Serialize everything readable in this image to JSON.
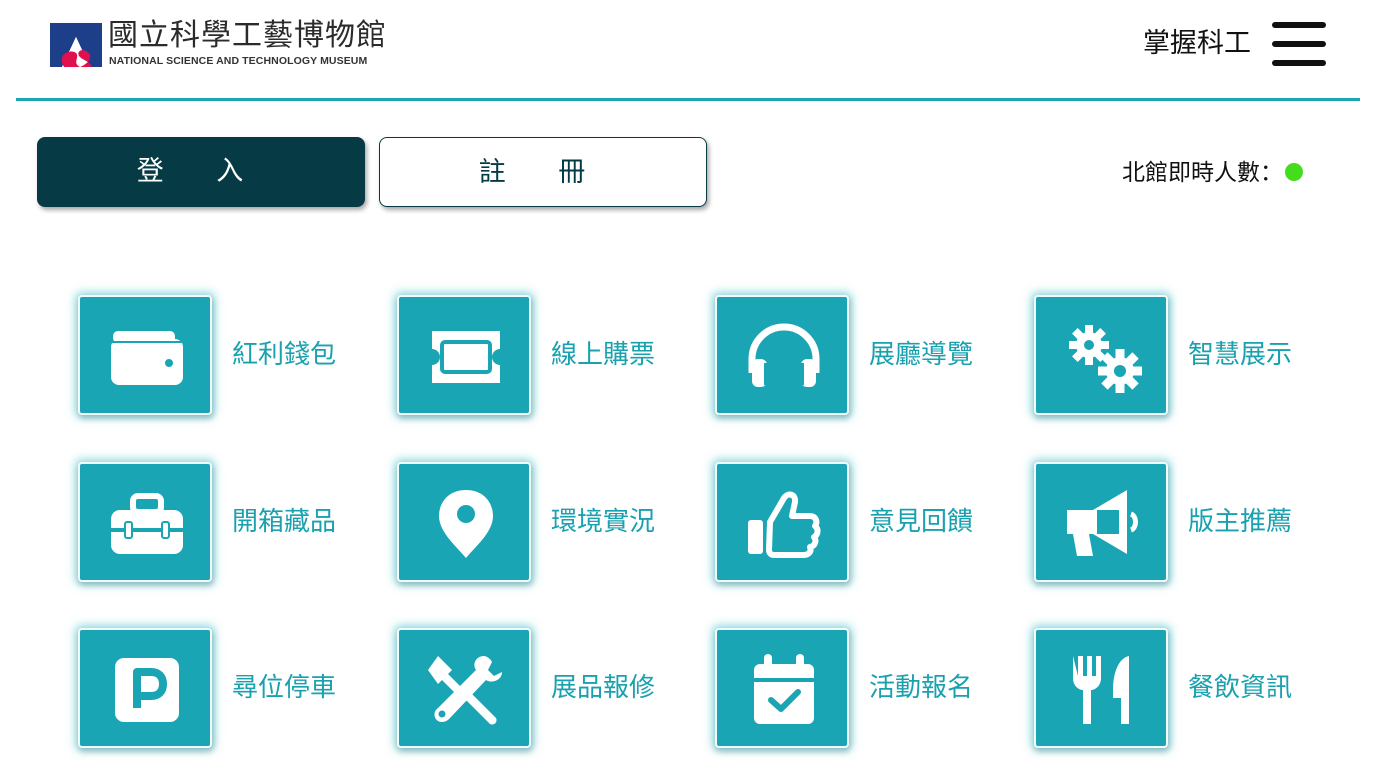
{
  "header": {
    "logo_zh": "國立科學工藝博物館",
    "logo_en": "NATIONAL SCIENCE AND TECHNOLOGY MUSEUM",
    "brand_link": "掌握科工",
    "menu_icon": "hamburger-menu-icon"
  },
  "auth": {
    "login_label": "登 入",
    "register_label": "註 冊"
  },
  "visitors": {
    "label": "北館即時人數：",
    "status_color": "#44dd1e"
  },
  "colors": {
    "accent": "#1aa5b5",
    "dark": "#063a45"
  },
  "grid": [
    {
      "label": "紅利錢包",
      "icon": "wallet-icon"
    },
    {
      "label": "線上購票",
      "icon": "ticket-icon"
    },
    {
      "label": "展廳導覽",
      "icon": "headphones-icon"
    },
    {
      "label": "智慧展示",
      "icon": "gears-icon"
    },
    {
      "label": "開箱藏品",
      "icon": "toolbox-icon"
    },
    {
      "label": "環境實況",
      "icon": "map-pin-icon"
    },
    {
      "label": "意見回饋",
      "icon": "thumbs-up-icon"
    },
    {
      "label": "版主推薦",
      "icon": "megaphone-icon"
    },
    {
      "label": "尋位停車",
      "icon": "parking-icon"
    },
    {
      "label": "展品報修",
      "icon": "tools-icon"
    },
    {
      "label": "活動報名",
      "icon": "calendar-check-icon"
    },
    {
      "label": "餐飲資訊",
      "icon": "utensils-icon"
    }
  ]
}
